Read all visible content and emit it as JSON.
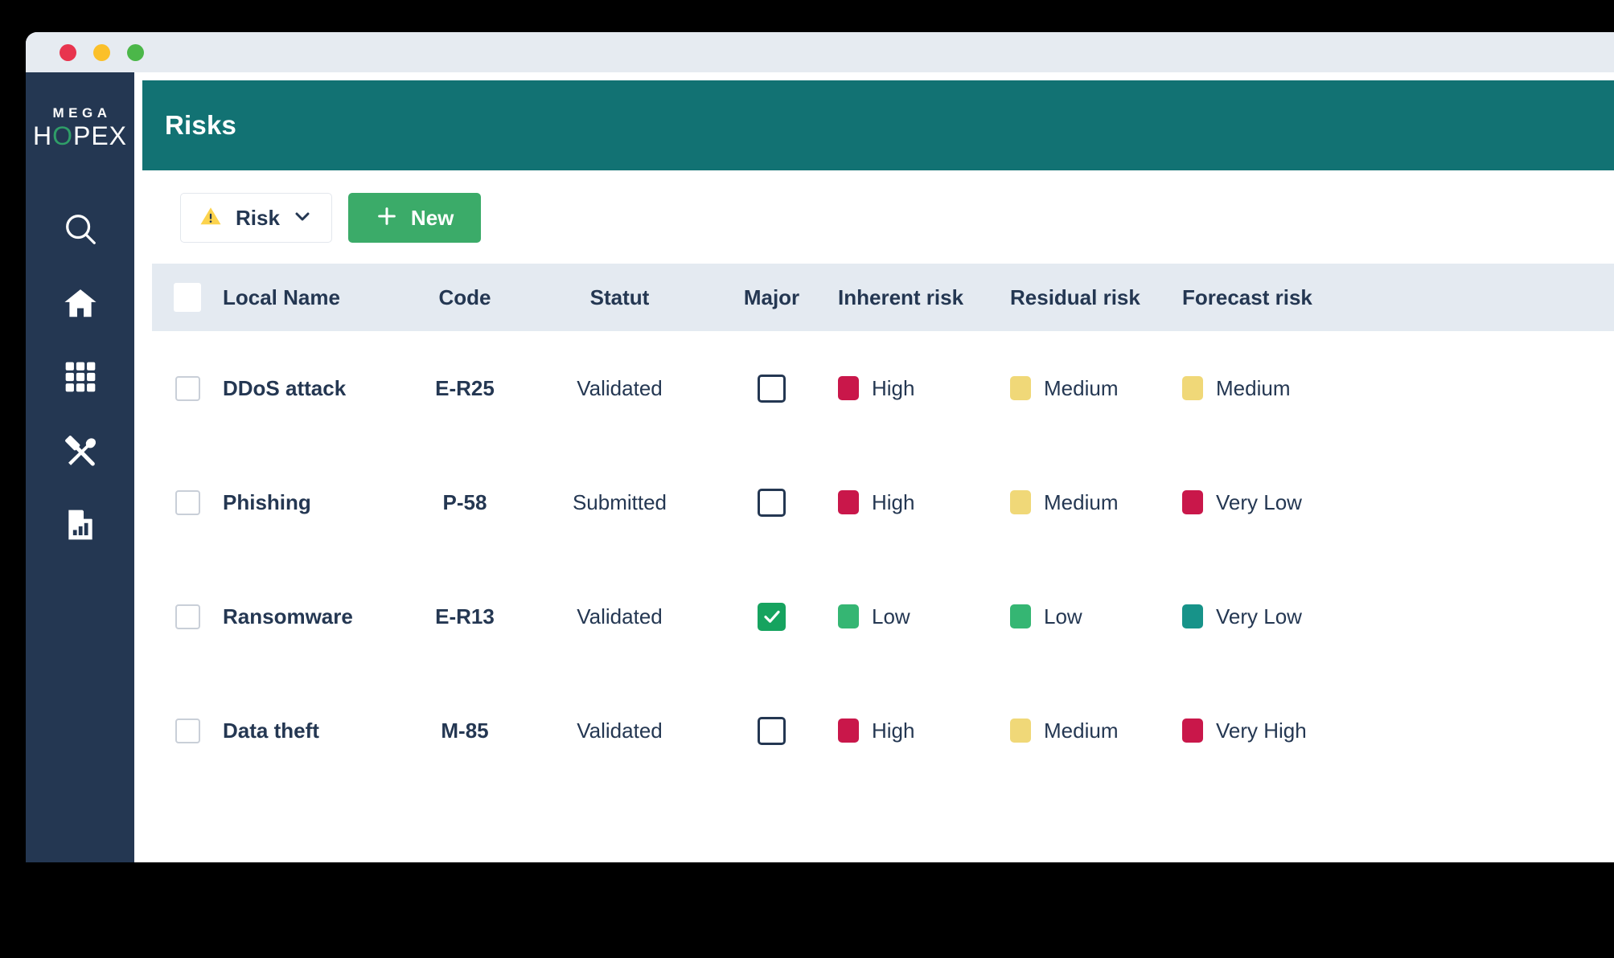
{
  "window": {
    "controls": [
      {
        "name": "close",
        "color": "#e8344e"
      },
      {
        "name": "minimize",
        "color": "#fbc02a"
      },
      {
        "name": "maximize",
        "color": "#4bb749"
      }
    ]
  },
  "sidebar": {
    "logo": {
      "top": "MEGA",
      "bottom_before": "H",
      "bottom_accent": "O",
      "bottom_after": "PEX",
      "accent_color": "#2f9e68"
    },
    "items": [
      {
        "icon": "search-icon",
        "label": "Search"
      },
      {
        "icon": "home-icon",
        "label": "Home"
      },
      {
        "icon": "apps-grid-icon",
        "label": "Apps"
      },
      {
        "icon": "tools-icon",
        "label": "Tools"
      },
      {
        "icon": "report-chart-icon",
        "label": "Reports"
      }
    ]
  },
  "header": {
    "title": "Risks",
    "background": "#127273"
  },
  "toolbar": {
    "risk_dropdown": {
      "label": "Risk",
      "icon": "warning-triangle-icon",
      "chevron": "chevron-down-icon"
    },
    "new_button": {
      "label": "New",
      "icon": "plus-icon",
      "color": "#3bab69"
    }
  },
  "table": {
    "columns": [
      "Local Name",
      "Code",
      "Statut",
      "Major",
      "Inherent risk",
      "Residual risk",
      "Forecast risk"
    ],
    "rows": [
      {
        "selected": false,
        "local_name": "DDoS attack",
        "code": "E-R25",
        "statut": "Validated",
        "major": false,
        "inherent_risk": {
          "label": "High",
          "color": "#c9174a"
        },
        "residual_risk": {
          "label": "Medium",
          "color": "#f0d878"
        },
        "forecast_risk": {
          "label": "Medium",
          "color": "#f0d878"
        }
      },
      {
        "selected": false,
        "local_name": "Phishing",
        "code": "P-58",
        "statut": "Submitted",
        "major": false,
        "inherent_risk": {
          "label": "High",
          "color": "#c9174a"
        },
        "residual_risk": {
          "label": "Medium",
          "color": "#f0d878"
        },
        "forecast_risk": {
          "label": "Very Low",
          "color": "#c9174a"
        }
      },
      {
        "selected": false,
        "local_name": "Ransomware",
        "code": "E-R13",
        "statut": "Validated",
        "major": true,
        "inherent_risk": {
          "label": "Low",
          "color": "#35b673"
        },
        "residual_risk": {
          "label": "Low",
          "color": "#35b673"
        },
        "forecast_risk": {
          "label": "Very Low",
          "color": "#179389"
        }
      },
      {
        "selected": false,
        "local_name": "Data theft",
        "code": "M-85",
        "statut": "Validated",
        "major": false,
        "inherent_risk": {
          "label": "High",
          "color": "#c9174a"
        },
        "residual_risk": {
          "label": "Medium",
          "color": "#f0d878"
        },
        "forecast_risk": {
          "label": "Very High",
          "color": "#c9174a"
        }
      }
    ]
  }
}
